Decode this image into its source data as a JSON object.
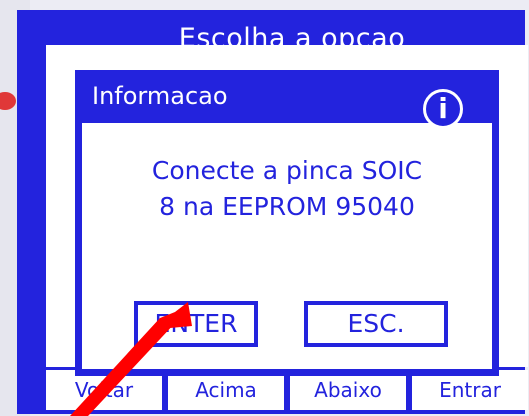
{
  "screen": {
    "title": "Escolha a opcao",
    "bottom_buttons": [
      "Voltar",
      "Acima",
      "Abaixo",
      "Entrar"
    ]
  },
  "dialog": {
    "title": "Informacao",
    "icon": "info-icon",
    "message_line1": "Conecte a pinca SOIC",
    "message_line2": "8 na EEPROM 95040",
    "enter_label": "ENTER",
    "esc_label": "ESC."
  },
  "colors": {
    "screen_blue": "#2323dd",
    "background": "#ffffff",
    "arrow_red": "#ff0000"
  }
}
